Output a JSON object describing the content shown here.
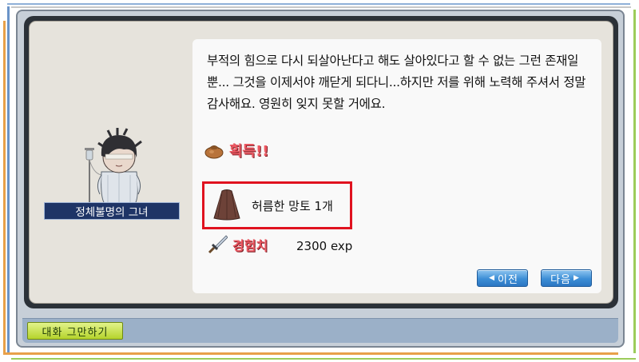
{
  "dialog": {
    "text": "부적의 힘으로 다시 되살아난다고 해도 살아있다고 할 수 없는 그런 존재일 뿐... 그것을 이제서야 깨닫게 되다니...하지만 저를 위해 노력해 주셔서 정말 감사해요. 영원히 잊지 못할 거에요."
  },
  "reward": {
    "label": "획득!!",
    "item_name": "허름한 망토 1개",
    "exp_label": "경험치",
    "exp_value": "2300 exp"
  },
  "npc": {
    "name": "정체불명의 그녀"
  },
  "buttons": {
    "prev_label": "이전",
    "next_label": "다음",
    "end_chat_label": "대화 그만하기"
  },
  "colors": {
    "highlight_border": "#e0121f",
    "reward_text": "#ec5862",
    "button_blue": "#3c8ed6",
    "end_chat_green": "#b5d42c",
    "npc_name_bg": "#1e3466"
  },
  "icons": {
    "reward": "bag-icon",
    "item": "cape-icon",
    "exp": "sword-icon",
    "prev": "arrow-left-icon",
    "next": "arrow-right-icon"
  }
}
